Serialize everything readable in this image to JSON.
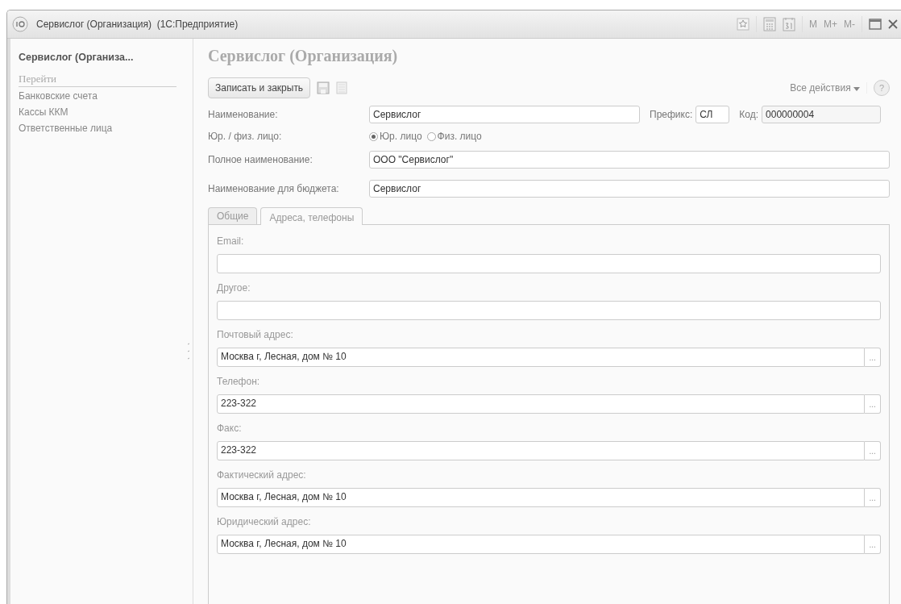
{
  "window": {
    "title": "Сервислог (Организация)  (1С:Предприятие)",
    "tools": [
      "M",
      "M+",
      "M-"
    ]
  },
  "sidebar": {
    "title": "Сервислог (Организа...",
    "section": "Перейти",
    "items": [
      "Банковские счета",
      "Кассы ККМ",
      "Ответственные лица"
    ]
  },
  "form": {
    "title": "Сервислог (Организация)",
    "save_button": "Записать и закрыть",
    "all_actions": "Все действия",
    "help": "?",
    "name_label": "Наименование:",
    "name": "Сервислог",
    "prefix_label": "Префикс:",
    "prefix": "СЛ",
    "code_label": "Код:",
    "code": "000000004",
    "type_label": "Юр. / физ. лицо:",
    "type_options": [
      {
        "label": "Юр. лицо",
        "selected": true
      },
      {
        "label": "Физ. лицо",
        "selected": false
      }
    ],
    "full_name_label": "Полное наименование:",
    "full_name": "ООО \"Сервислог\"",
    "budget_name_label": "Наименование для бюджета:",
    "budget_name": "Сервислог"
  },
  "tabs": [
    {
      "label": "Общие",
      "selected": false
    },
    {
      "label": "Адреса, телефоны",
      "selected": true
    }
  ],
  "contacts": [
    {
      "label": "Email:",
      "kind": "plain"
    },
    {
      "label": "Другое:",
      "kind": "plain"
    },
    {
      "label": "Почтовый адрес:",
      "value": "Москва г, Лесная, дом № 10",
      "kind": "choice",
      "button": "..."
    },
    {
      "label": "Телефон:",
      "value": "223-322",
      "kind": "choice",
      "button": "..."
    },
    {
      "label": "Факс:",
      "value": "223-322",
      "kind": "choice",
      "button": "..."
    },
    {
      "label": "Фактический адрес:",
      "value": "Москва г, Лесная, дом № 10",
      "kind": "choice",
      "button": "..."
    },
    {
      "label": "Юридический адрес:",
      "value": "Москва г, Лесная, дом № 10",
      "kind": "choice",
      "button": "..."
    }
  ]
}
